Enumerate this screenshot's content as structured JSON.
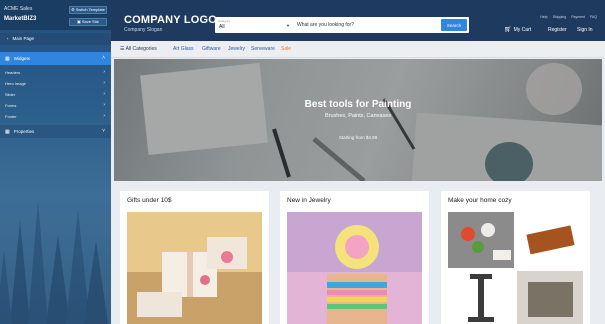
{
  "sidebar": {
    "app_name": "ACME Sales",
    "brand": "MarketBIZ3",
    "switch_template_label": "Switch Template",
    "save_site_label": "Save Site",
    "main_page_label": "Main Page",
    "widgets_label": "Widgets",
    "items": [
      {
        "label": "Headers"
      },
      {
        "label": "Hero Image"
      },
      {
        "label": "Slider"
      },
      {
        "label": "Forms"
      },
      {
        "label": "Footer"
      }
    ],
    "properties_label": "Properties"
  },
  "header": {
    "logo": "COMPANY LOGO",
    "slogan": "Company Slogan",
    "category_label": "Category",
    "category_value": "All",
    "search_placeholder": "What are you looking for?",
    "search_button": "Search",
    "top_links": [
      "Help",
      "Shipping",
      "Payment",
      "FAQ"
    ],
    "cart_label": "My Cart",
    "register_label": "Register",
    "signin_label": "Sign In"
  },
  "nav": {
    "all_categories": "All Categories",
    "items": [
      "Art Glass",
      "Giftware",
      "Jewelry",
      "Serveware"
    ],
    "sale": "Sale"
  },
  "hero": {
    "title": "Best tools for Painting",
    "subtitle": "Brushes, Paints, Canvases",
    "price": "Starting from $4.99",
    "slide_count": 5,
    "active_slide": 1
  },
  "cards": [
    {
      "title": "Gifts under 10$"
    },
    {
      "title": "New in Jewelry"
    },
    {
      "title": "Make your home cozy"
    }
  ],
  "colors": {
    "header_bg": "#1e3a5f",
    "accent": "#2e86de",
    "sale": "#e8792b",
    "link": "#2b5c93"
  }
}
